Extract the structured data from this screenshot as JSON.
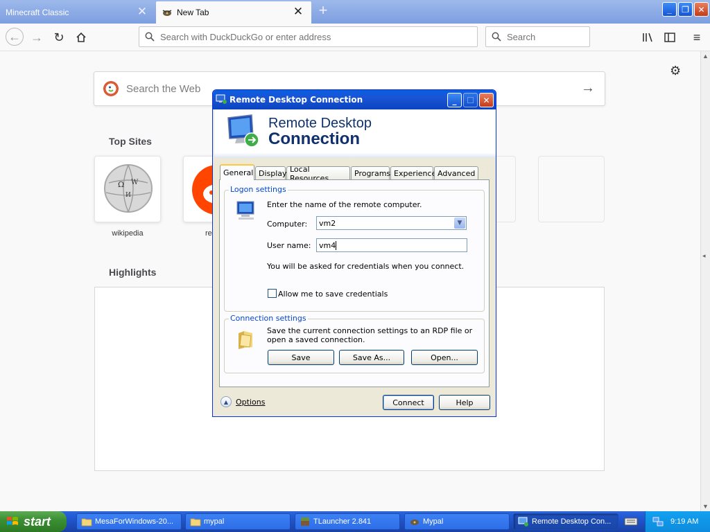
{
  "browser": {
    "tabs": [
      {
        "label": "Minecraft Classic",
        "active": false
      },
      {
        "label": "New Tab",
        "active": true
      }
    ],
    "address_placeholder": "Search with DuckDuckGo or enter address",
    "search_placeholder": "Search"
  },
  "newtab": {
    "web_search_placeholder": "Search the Web",
    "top_sites_title": "Top Sites",
    "top_sites": [
      {
        "label": "wikipedia"
      },
      {
        "label": "re"
      }
    ],
    "highlights_title": "Highlights"
  },
  "dialog": {
    "title": "Remote Desktop Connection",
    "header_line1": "Remote Desktop",
    "header_line2": "Connection",
    "tabs": [
      "General",
      "Display",
      "Local Resources",
      "Programs",
      "Experience",
      "Advanced"
    ],
    "logon_settings": {
      "legend": "Logon settings",
      "instruction": "Enter the name of the remote computer.",
      "computer_label": "Computer:",
      "computer_value": "vm2",
      "username_label": "User name:",
      "username_value": "vm4",
      "credentials_note": "You will be asked for credentials when you connect.",
      "save_credentials_label": "Allow me to save credentials",
      "save_credentials_checked": false
    },
    "connection_settings": {
      "legend": "Connection settings",
      "description": "Save the current connection settings to an RDP file or open a saved connection.",
      "save_label": "Save",
      "save_as_label": "Save As...",
      "open_label": "Open..."
    },
    "options_label": "Options",
    "connect_label": "Connect",
    "help_label": "Help"
  },
  "taskbar": {
    "start_label": "start",
    "items": [
      {
        "label": "MesaForWindows-20..."
      },
      {
        "label": "mypal"
      },
      {
        "label": "TLauncher 2.841"
      },
      {
        "label": "Mypal"
      },
      {
        "label": "Remote Desktop Con..."
      }
    ],
    "clock": "9:19 AM"
  },
  "colors": {
    "xp_title_blue": "#0a5ee4",
    "xp_start_green": "#3c8f34",
    "firefox_tabbar": "#8aa9e6",
    "legend_blue": "#0046d5"
  }
}
